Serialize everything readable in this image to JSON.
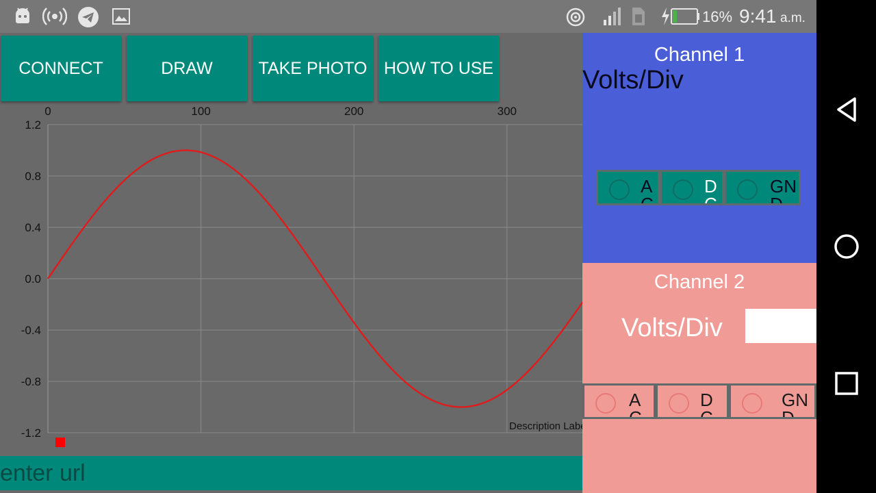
{
  "status_bar": {
    "battery": "16%",
    "time": "9:41",
    "ampm": "a.m."
  },
  "toolbar": {
    "connect_label": "CONNECT",
    "draw_label": "DRAW",
    "take_photo_label": "TAKE PHOTO",
    "how_to_use_label": "HOW TO USE"
  },
  "chart_data": {
    "type": "line",
    "x_ticks": [
      "0",
      "100",
      "200",
      "300"
    ],
    "y_ticks": [
      "1.2",
      "0.8",
      "0.4",
      "0.0",
      "-0.4",
      "-0.8",
      "-1.2"
    ],
    "xlim": [
      0,
      350
    ],
    "ylim": [
      -1.2,
      1.2
    ],
    "x_axis_position": "top",
    "grid": true,
    "description": "Description Label",
    "series": [
      {
        "color": "#e01b1b",
        "function": "sin",
        "period": 360,
        "amplitude": 1,
        "x": [
          0,
          350
        ]
      }
    ]
  },
  "url_input": {
    "placeholder": "enter url"
  },
  "channel1": {
    "title": "Channel 1",
    "volts_label": "Volts/Div",
    "options": [
      "AC",
      "DC",
      "GND"
    ]
  },
  "channel2": {
    "title": "Channel 2",
    "volts_label": "Volts/Div",
    "volts_value": "",
    "options": [
      "AC",
      "DC",
      "GND"
    ]
  },
  "colors": {
    "accent": "#00897b",
    "channel1_bg": "#4a5ed8",
    "channel2_bg": "#f19b97",
    "plot_bg": "#696969"
  }
}
